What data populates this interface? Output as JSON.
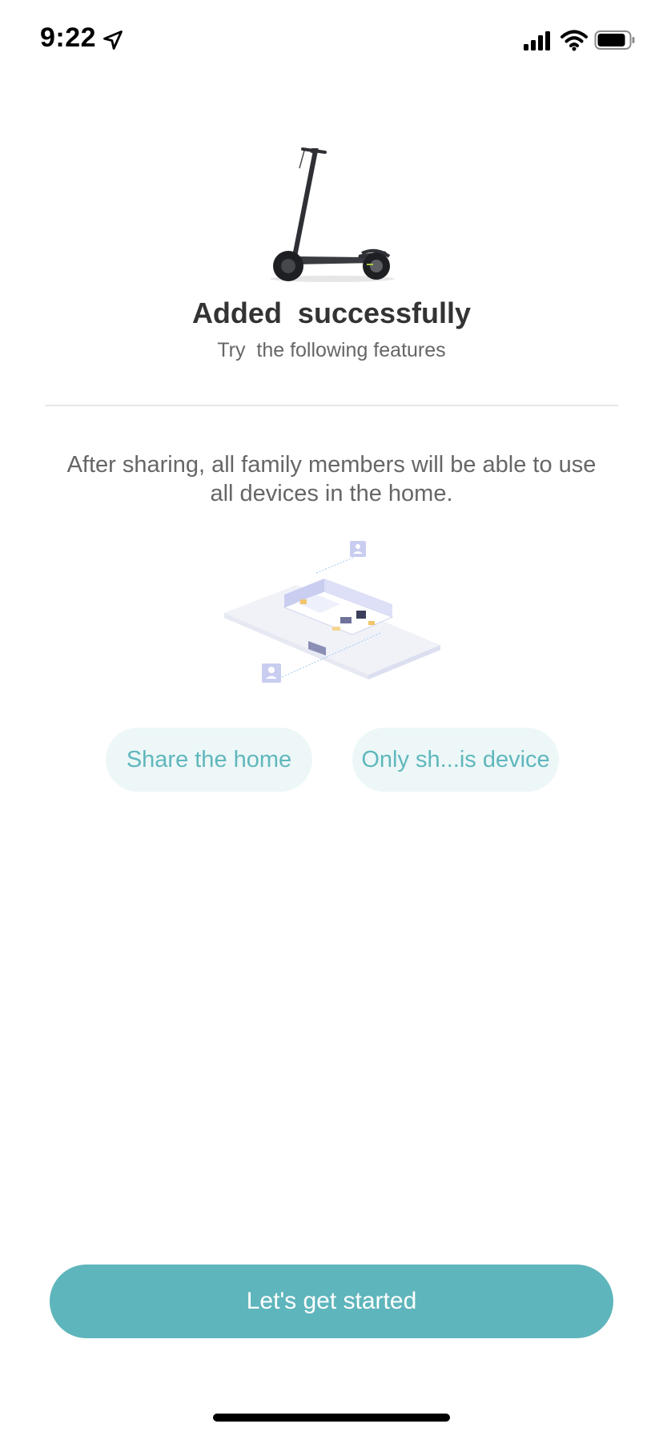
{
  "status_bar": {
    "time": "9:22",
    "icons": [
      "location-arrow-icon",
      "cellular-signal-icon",
      "wifi-icon",
      "battery-icon"
    ]
  },
  "hero": {
    "image": "electric-scooter",
    "title": "Added  successfully",
    "subtitle": "Try  the following features"
  },
  "sharing": {
    "description": "After sharing, all family members will be able to use all devices in the home.",
    "illustration": "isometric-home-sharing"
  },
  "options": {
    "share_home": "Share the home",
    "share_device": "Only sh...is device"
  },
  "actions": {
    "get_started": "Let's get started"
  },
  "colors": {
    "accent": "#5fb5bc",
    "pill_bg": "#edf7f7",
    "pill_text": "#5fb7bd"
  }
}
